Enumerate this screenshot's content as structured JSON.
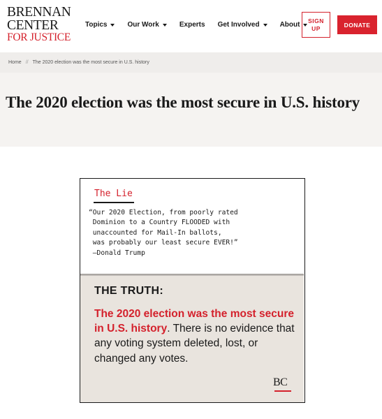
{
  "logo": {
    "line1": "BRENNAN",
    "line2": "CENTER",
    "line3": "FOR JUSTICE"
  },
  "nav": {
    "items": [
      {
        "label": "Topics",
        "has_dropdown": true,
        "icon": "caret-down-icon"
      },
      {
        "label": "Our Work",
        "has_dropdown": true,
        "icon": "caret-down-icon"
      },
      {
        "label": "Experts",
        "has_dropdown": false
      },
      {
        "label": "Get Involved",
        "has_dropdown": true,
        "icon": "caret-down-icon"
      },
      {
        "label": "About",
        "has_dropdown": true,
        "icon": "caret-down-icon"
      }
    ],
    "signup_line1": "SIGN",
    "signup_line2": "UP",
    "donate_label": "DONATE"
  },
  "breadcrumb": {
    "home": "Home",
    "separator": "//",
    "current": "The 2020 election was the most secure in U.S. history"
  },
  "page": {
    "title": "The 2020 election was the most secure in U.S. history"
  },
  "graphic": {
    "lie_label": "The Lie",
    "quote_lines": [
      "“Our 2020 Election, from poorly rated",
      " Dominion to a Country FLOODED with",
      " unaccounted for Mail-In ballots,",
      " was probably our least secure EVER!”",
      " —Donald Trump"
    ],
    "truth_heading": "THE TRUTH:",
    "truth_highlight": "The 2020 election was the most secure in U.S. history",
    "truth_period": ".",
    "truth_rest": "There is no evidence that any voting system deleted, lost, or changed any votes.",
    "mark": "BC"
  },
  "colors": {
    "brand_red": "#d4212c",
    "donate_bg": "#d9232e",
    "breadcrumb_bg": "#efedeb",
    "title_band_bg": "#f5f3f1",
    "truth_bg": "#e9e4de"
  }
}
